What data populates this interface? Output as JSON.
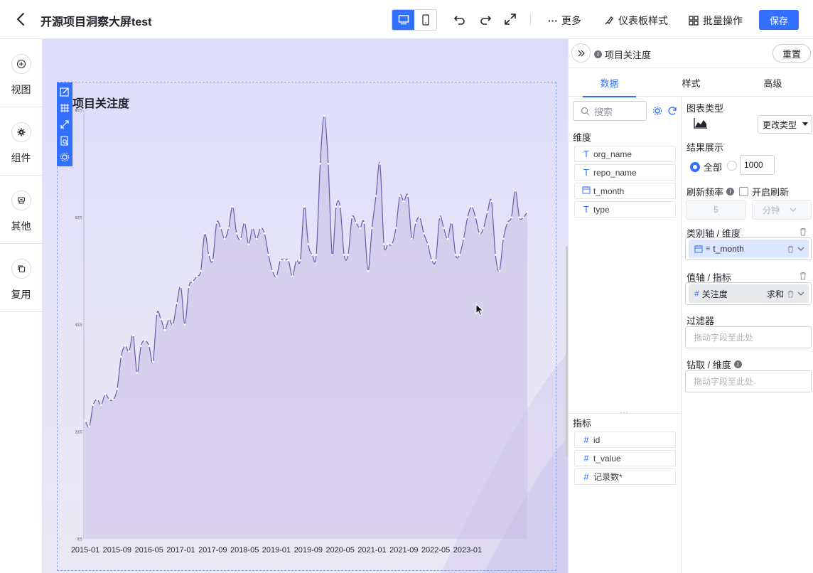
{
  "header": {
    "title": "开源项目洞察大屏test",
    "more": "更多",
    "dashboard_style": "仪表板样式",
    "batch_ops": "批量操作",
    "save": "保存"
  },
  "rail": [
    {
      "label": "视图",
      "icon": "plus-circle-icon"
    },
    {
      "label": "组件",
      "icon": "gear-icon"
    },
    {
      "label": "其他",
      "icon": "box-icon"
    },
    {
      "label": "复用",
      "icon": "copy-icon"
    }
  ],
  "panel": {
    "title": "项目关注度"
  },
  "right": {
    "title": "项目关注度",
    "reset": "重置",
    "tabs": [
      "数据",
      "样式",
      "高级"
    ],
    "search_placeholder": "搜索",
    "dimensions_label": "维度",
    "dimensions": [
      {
        "type": "T",
        "name": "org_name"
      },
      {
        "type": "T",
        "name": "repo_name"
      },
      {
        "type": "date",
        "name": "t_month"
      },
      {
        "type": "T",
        "name": "type"
      }
    ],
    "metrics_label": "指标",
    "metrics": [
      {
        "type": "#",
        "name": "id"
      },
      {
        "type": "#",
        "name": "t_value"
      },
      {
        "type": "#",
        "name": "记录数*"
      }
    ],
    "chart_type_label": "图表类型",
    "change_type": "更改类型",
    "result_label": "结果展示",
    "result_all": "全部",
    "result_limit": "1000",
    "refresh_label": "刷新频率",
    "refresh_enable": "开启刷新",
    "refresh_value": "5",
    "refresh_unit": "分钟",
    "category_axis_label": "类别轴 / 维度",
    "category_field": "t_month",
    "value_axis_label": "值轴 / 指标",
    "value_field": "关注度",
    "value_agg": "求和",
    "filter_label": "过滤器",
    "filter_placeholder": "拖动字段至此处",
    "drill_label": "钻取 / 维度",
    "drill_placeholder": "拖动字段至此处"
  },
  "colors": {
    "accent": "#3370ff",
    "series": "#6a5aa8",
    "area": "#c9bfe6"
  },
  "chart_data": {
    "type": "area",
    "title": "项目关注度",
    "x_tick_labels": [
      "2015-01",
      "2015-09",
      "2016-05",
      "2017-01",
      "2017-09",
      "2018-05",
      "2019-01",
      "2019-09",
      "2020-05",
      "2021-01",
      "2021-09",
      "2022-05",
      "2023-01"
    ],
    "y_tick_labels": [
      "0万",
      "20万",
      "40万",
      "60万",
      "80万"
    ],
    "ylim": [
      0,
      80
    ],
    "x_start": "2015-01",
    "series": [
      {
        "values": [
          22,
          21,
          25,
          26,
          25,
          27,
          26,
          26,
          28,
          34,
          36,
          35,
          38,
          31,
          36,
          37,
          36,
          33,
          42,
          41,
          39,
          41,
          40,
          44,
          47,
          40,
          47,
          48,
          49,
          50,
          57,
          53,
          52,
          59,
          58,
          56,
          58,
          62,
          57,
          56,
          59,
          55,
          58,
          56,
          58,
          57,
          53,
          50,
          49,
          52,
          52,
          52,
          49,
          52,
          52,
          62,
          55,
          53,
          53,
          70,
          79,
          70,
          53,
          62,
          62,
          53,
          53,
          60,
          59,
          58,
          59,
          50,
          58,
          64,
          70,
          55,
          55,
          55,
          58,
          64,
          63,
          64,
          56,
          59,
          60,
          57,
          55,
          52,
          52,
          60,
          58,
          56,
          59,
          53,
          53,
          56,
          60,
          62,
          60,
          57,
          58,
          61,
          63,
          53,
          50,
          56,
          59,
          60,
          65,
          60,
          60,
          61
        ],
        "note": ""
      }
    ]
  }
}
